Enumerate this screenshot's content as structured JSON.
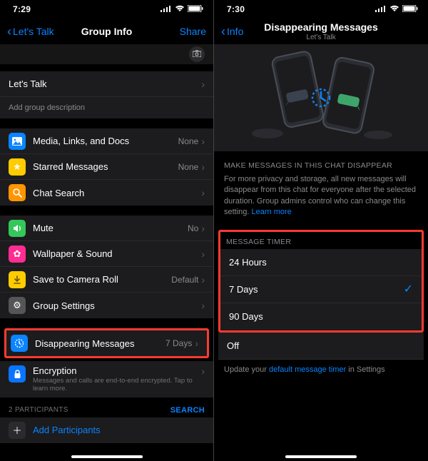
{
  "left": {
    "status": {
      "time": "7:29"
    },
    "nav": {
      "back": "Let's Talk",
      "title": "Group Info",
      "action": "Share"
    },
    "groupName": "Let's Talk",
    "addDescription": "Add group description",
    "rows": {
      "media": {
        "label": "Media, Links, and Docs",
        "value": "None"
      },
      "starred": {
        "label": "Starred Messages",
        "value": "None"
      },
      "search": {
        "label": "Chat Search"
      },
      "mute": {
        "label": "Mute",
        "value": "No"
      },
      "wallpaper": {
        "label": "Wallpaper & Sound"
      },
      "save": {
        "label": "Save to Camera Roll",
        "value": "Default"
      },
      "settings": {
        "label": "Group Settings"
      },
      "disappearing": {
        "label": "Disappearing Messages",
        "value": "7 Days"
      },
      "encryption": {
        "label": "Encryption",
        "footer": "Messages and calls are end-to-end encrypted. Tap to learn more."
      }
    },
    "participantsHeader": "2 PARTICIPANTS",
    "searchLink": "SEARCH",
    "addParticipants": "Add Participants"
  },
  "right": {
    "status": {
      "time": "7:30"
    },
    "nav": {
      "back": "Info",
      "title": "Disappearing Messages",
      "subtitle": "Let's Talk"
    },
    "descHeader": "MAKE MESSAGES IN THIS CHAT DISAPPEAR",
    "descBody": "For more privacy and storage, all new messages will disappear from this chat for everyone after the selected duration. Group admins control who can change this setting.",
    "learnMore": "Learn more",
    "timerHeader": "MESSAGE TIMER",
    "options": {
      "h24": "24 Hours",
      "d7": "7 Days",
      "d90": "90 Days",
      "off": "Off"
    },
    "selected": "d7",
    "updateFooter1": "Update your ",
    "updateFooterLink": "default message timer",
    "updateFooter2": " in Settings"
  }
}
